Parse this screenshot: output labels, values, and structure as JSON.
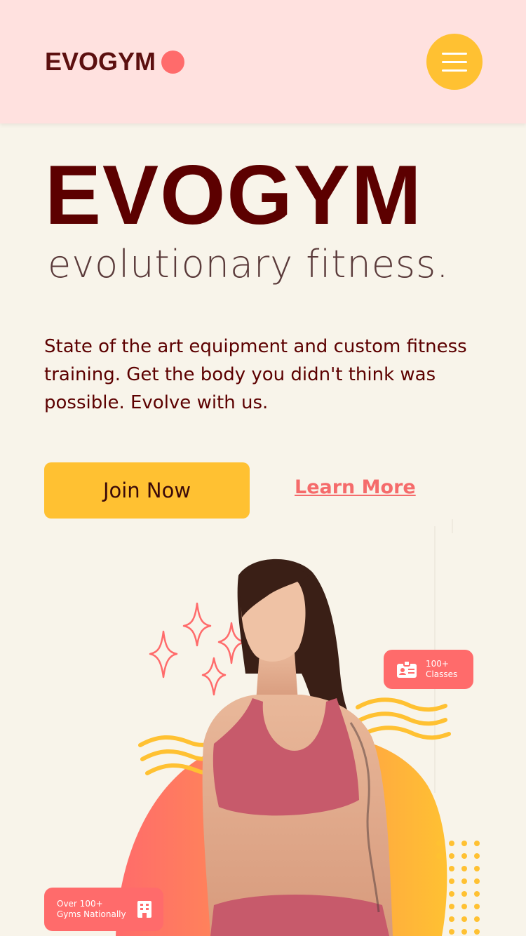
{
  "navbar": {
    "logo_text": "EVOGYM",
    "menu_icon": "hamburger-icon"
  },
  "hero": {
    "title": "EVOGYM",
    "subtitle": "evolutionary fitness.",
    "description": "State of the art equipment and custom fitness training. Get the body you didn't think was possible. Evolve with us.",
    "join_button_label": "Join Now",
    "learn_more_label": "Learn More"
  },
  "badges": {
    "classes": {
      "line1": "100+",
      "line2": "Classes",
      "icon": "id-card-icon"
    },
    "gyms": {
      "line1": "Over 100+",
      "line2": "Gyms Nationally",
      "icon": "building-icon"
    }
  },
  "colors": {
    "navbar_bg": "#ffe1df",
    "page_bg": "#f8f4ea",
    "brand_dark": "#5c0000",
    "accent_yellow": "#ffc132",
    "accent_coral": "#ff6b6b"
  }
}
